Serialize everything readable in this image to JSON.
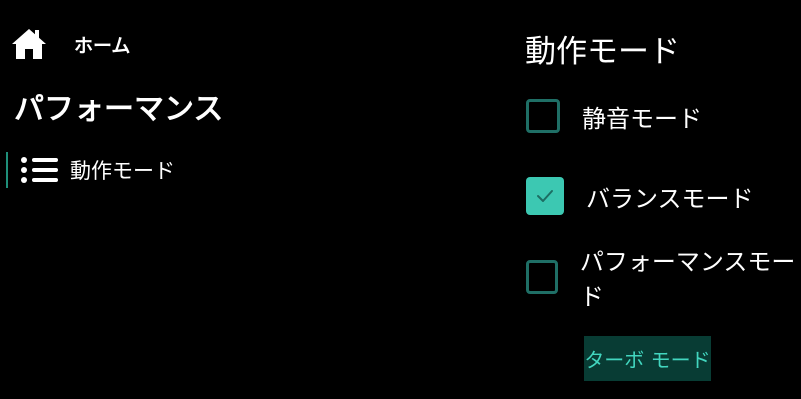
{
  "home": {
    "icon": "home-icon",
    "label": "ホーム"
  },
  "page_title": "パフォーマンス",
  "nav": {
    "items": [
      {
        "icon": "list-icon",
        "label": "動作モード",
        "selected": true
      }
    ]
  },
  "section": {
    "title": "動作モード",
    "options": [
      {
        "label": "静音モード",
        "checked": false
      },
      {
        "label": "バランスモード",
        "checked": true
      },
      {
        "label": "パフォーマンスモード",
        "checked": false
      }
    ]
  },
  "turbo_button": {
    "label": "ターボ モード"
  },
  "colors": {
    "background": "#000000",
    "accent": "#3cc8b2",
    "checkbox_border": "#1f6f66",
    "button_bg": "#083c34",
    "button_text": "#42d6bf"
  }
}
